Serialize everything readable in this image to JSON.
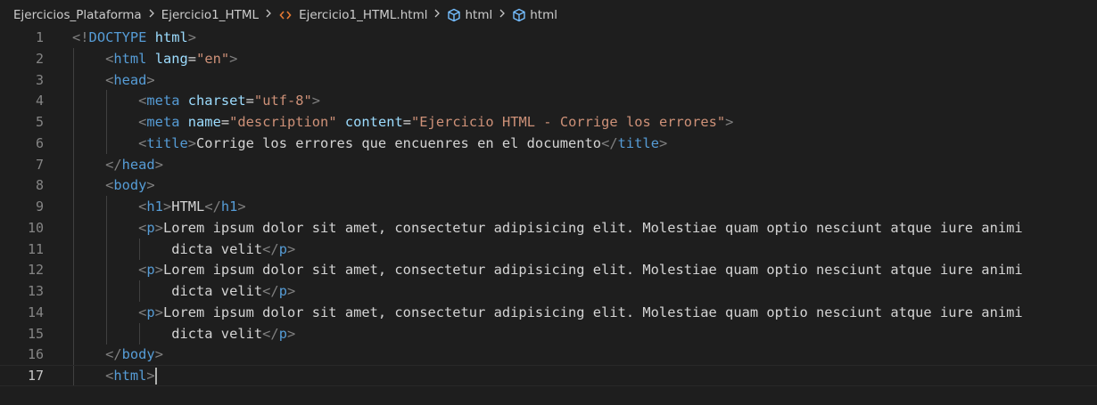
{
  "breadcrumb": {
    "items": [
      {
        "label": "Ejercicios_Plataforma",
        "icon": null
      },
      {
        "label": "Ejercicio1_HTML",
        "icon": null
      },
      {
        "label": "Ejercicio1_HTML.html",
        "icon": "html-file-icon"
      },
      {
        "label": "html",
        "icon": "element-cube-icon"
      },
      {
        "label": "html",
        "icon": "element-cube-icon"
      }
    ],
    "separator_icon": "chevron-right-icon"
  },
  "editor": {
    "current_line": 17,
    "lines": [
      {
        "n": "1",
        "indent": 0,
        "tokens": [
          [
            "punct",
            "<!"
          ],
          [
            "tag",
            "DOCTYPE"
          ],
          [
            "text",
            " "
          ],
          [
            "attr",
            "html"
          ],
          [
            "punct",
            ">"
          ]
        ]
      },
      {
        "n": "2",
        "indent": 1,
        "tokens": [
          [
            "punct",
            "<"
          ],
          [
            "tag",
            "html"
          ],
          [
            "text",
            " "
          ],
          [
            "attr",
            "lang"
          ],
          [
            "text",
            "="
          ],
          [
            "str",
            "\"en\""
          ],
          [
            "punct",
            ">"
          ]
        ]
      },
      {
        "n": "3",
        "indent": 1,
        "tokens": [
          [
            "punct",
            "<"
          ],
          [
            "tag",
            "head"
          ],
          [
            "punct",
            ">"
          ]
        ]
      },
      {
        "n": "4",
        "indent": 2,
        "tokens": [
          [
            "punct",
            "<"
          ],
          [
            "tag",
            "meta"
          ],
          [
            "text",
            " "
          ],
          [
            "attr",
            "charset"
          ],
          [
            "text",
            "="
          ],
          [
            "str",
            "\"utf-8\""
          ],
          [
            "punct",
            ">"
          ]
        ]
      },
      {
        "n": "5",
        "indent": 2,
        "tokens": [
          [
            "punct",
            "<"
          ],
          [
            "tag",
            "meta"
          ],
          [
            "text",
            " "
          ],
          [
            "attr",
            "name"
          ],
          [
            "text",
            "="
          ],
          [
            "str",
            "\"description\""
          ],
          [
            "text",
            " "
          ],
          [
            "attr",
            "content"
          ],
          [
            "text",
            "="
          ],
          [
            "str",
            "\"Ejercicio HTML - Corrige los errores\""
          ],
          [
            "punct",
            ">"
          ]
        ]
      },
      {
        "n": "6",
        "indent": 2,
        "tokens": [
          [
            "punct",
            "<"
          ],
          [
            "tag",
            "title"
          ],
          [
            "punct",
            ">"
          ],
          [
            "text",
            "Corrige los errores que encuenres en el documento"
          ],
          [
            "punct",
            "</"
          ],
          [
            "tag",
            "title"
          ],
          [
            "punct",
            ">"
          ]
        ]
      },
      {
        "n": "7",
        "indent": 1,
        "tokens": [
          [
            "punct",
            "</"
          ],
          [
            "tag",
            "head"
          ],
          [
            "punct",
            ">"
          ]
        ]
      },
      {
        "n": "8",
        "indent": 1,
        "tokens": [
          [
            "punct",
            "<"
          ],
          [
            "tag",
            "body"
          ],
          [
            "punct",
            ">"
          ]
        ]
      },
      {
        "n": "9",
        "indent": 2,
        "tokens": [
          [
            "punct",
            "<"
          ],
          [
            "tag",
            "h1"
          ],
          [
            "punct",
            ">"
          ],
          [
            "text",
            "HTML"
          ],
          [
            "punct",
            "</"
          ],
          [
            "tag",
            "h1"
          ],
          [
            "punct",
            ">"
          ]
        ]
      },
      {
        "n": "10",
        "indent": 2,
        "tokens": [
          [
            "punct",
            "<"
          ],
          [
            "tag",
            "p"
          ],
          [
            "punct",
            ">"
          ],
          [
            "text",
            "Lorem ipsum dolor sit amet, consectetur adipisicing elit. Molestiae quam optio nesciunt atque iure animi"
          ]
        ]
      },
      {
        "n": "11",
        "indent": 3,
        "tokens": [
          [
            "text",
            "dicta velit"
          ],
          [
            "punct",
            "</"
          ],
          [
            "tag",
            "p"
          ],
          [
            "punct",
            ">"
          ]
        ]
      },
      {
        "n": "12",
        "indent": 2,
        "tokens": [
          [
            "punct",
            "<"
          ],
          [
            "tag",
            "p"
          ],
          [
            "punct",
            ">"
          ],
          [
            "text",
            "Lorem ipsum dolor sit amet, consectetur adipisicing elit. Molestiae quam optio nesciunt atque iure animi"
          ]
        ]
      },
      {
        "n": "13",
        "indent": 3,
        "tokens": [
          [
            "text",
            "dicta velit"
          ],
          [
            "punct",
            "</"
          ],
          [
            "tag",
            "p"
          ],
          [
            "punct",
            ">"
          ]
        ]
      },
      {
        "n": "14",
        "indent": 2,
        "tokens": [
          [
            "punct",
            "<"
          ],
          [
            "tag",
            "p"
          ],
          [
            "punct",
            ">"
          ],
          [
            "text",
            "Lorem ipsum dolor sit amet, consectetur adipisicing elit. Molestiae quam optio nesciunt atque iure animi"
          ]
        ]
      },
      {
        "n": "15",
        "indent": 3,
        "tokens": [
          [
            "text",
            "dicta velit"
          ],
          [
            "punct",
            "</"
          ],
          [
            "tag",
            "p"
          ],
          [
            "punct",
            ">"
          ]
        ]
      },
      {
        "n": "16",
        "indent": 1,
        "tokens": [
          [
            "punct",
            "</"
          ],
          [
            "tag",
            "body"
          ],
          [
            "punct",
            ">"
          ]
        ]
      },
      {
        "n": "17",
        "indent": 1,
        "tokens": [
          [
            "punct",
            "<"
          ],
          [
            "tag",
            "html"
          ],
          [
            "punct",
            ">"
          ]
        ]
      }
    ]
  },
  "colors": {
    "background": "#1e1e1e",
    "punct": "#808080",
    "tag": "#569cd6",
    "attr": "#9cdcfe",
    "string": "#ce9178",
    "text": "#d4d4d4",
    "line_number": "#858585",
    "html_icon": "#e37933",
    "cube_icon": "#75beff"
  }
}
